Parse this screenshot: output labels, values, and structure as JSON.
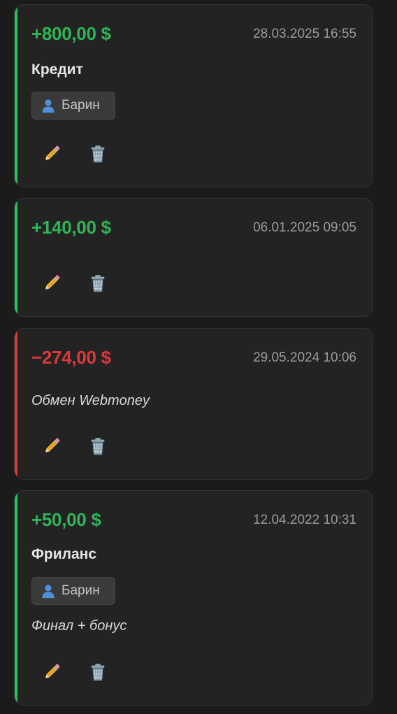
{
  "colors": {
    "income": "#2fb457",
    "expense": "#dc3a3a",
    "card_bg": "#232323",
    "page_bg": "#1b1b1b"
  },
  "transactions": [
    {
      "type": "income",
      "amount": "+800,00 $",
      "date": "28.03.2025 16:55",
      "category": "Кредит",
      "person": "Барин",
      "comment": ""
    },
    {
      "type": "income",
      "amount": "+140,00 $",
      "date": "06.01.2025 09:05",
      "category": "",
      "person": "",
      "comment": ""
    },
    {
      "type": "expense",
      "amount": "−274,00 $",
      "date": "29.05.2024 10:06",
      "category": "",
      "person": "",
      "comment": "Обмен Webmoney"
    },
    {
      "type": "income",
      "amount": "+50,00 $",
      "date": "12.04.2022 10:31",
      "category": "Фриланс",
      "person": "Барин",
      "comment": "Финал + бонус"
    }
  ],
  "icons": {
    "edit": "pencil-icon",
    "delete": "trash-icon",
    "person": "person-icon"
  }
}
